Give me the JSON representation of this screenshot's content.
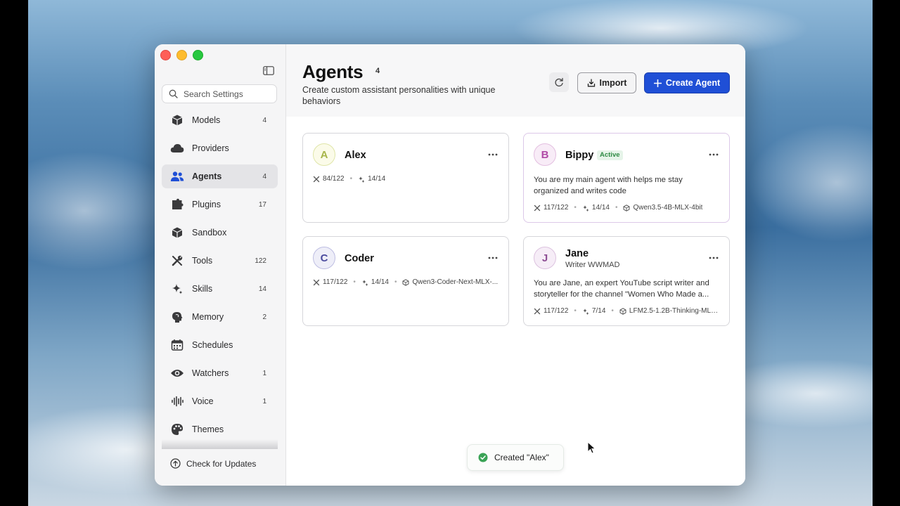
{
  "sidebar": {
    "search_placeholder": "Search Settings",
    "items": [
      {
        "label": "Models",
        "count": "4",
        "icon": "cube-icon"
      },
      {
        "label": "Providers",
        "count": "",
        "icon": "cloud-icon"
      },
      {
        "label": "Agents",
        "count": "4",
        "icon": "people-icon",
        "active": true
      },
      {
        "label": "Plugins",
        "count": "17",
        "icon": "plugin-icon"
      },
      {
        "label": "Sandbox",
        "count": "",
        "icon": "box-icon"
      },
      {
        "label": "Tools",
        "count": "122",
        "icon": "tools-icon"
      },
      {
        "label": "Skills",
        "count": "14",
        "icon": "sparkle-icon"
      },
      {
        "label": "Memory",
        "count": "2",
        "icon": "brain-icon"
      },
      {
        "label": "Schedules",
        "count": "",
        "icon": "calendar-icon"
      },
      {
        "label": "Watchers",
        "count": "1",
        "icon": "eye-icon"
      },
      {
        "label": "Voice",
        "count": "1",
        "icon": "waveform-icon"
      },
      {
        "label": "Themes",
        "count": "",
        "icon": "palette-icon"
      }
    ],
    "check_updates": "Check for Updates"
  },
  "header": {
    "title": "Agents",
    "count": "4",
    "subtitle": "Create custom assistant personalities with unique behaviors",
    "import_label": "Import",
    "create_label": "Create Agent"
  },
  "agents": [
    {
      "initial": "A",
      "name": "Alex",
      "role": "",
      "badge": "",
      "desc1": "",
      "desc2": "",
      "tools": "84/122",
      "skills": "14/14",
      "model": "",
      "colors": {
        "bg": "#fbfbe9",
        "border": "#dfe5a8",
        "text": "#a7b54a"
      }
    },
    {
      "initial": "B",
      "name": "Bippy",
      "role": "",
      "badge": "Active",
      "desc1": "You are my main agent with helps me stay",
      "desc2": "organized and writes code",
      "tools": "117/122",
      "skills": "14/14",
      "model": "Qwen3.5-4B-MLX-4bit",
      "colors": {
        "bg": "#f8ecf7",
        "border": "#e3bfe0",
        "text": "#b04aa6"
      }
    },
    {
      "initial": "C",
      "name": "Coder",
      "role": "",
      "badge": "",
      "desc1": "",
      "desc2": "",
      "tools": "117/122",
      "skills": "14/14",
      "model": "Qwen3-Coder-Next-MLX-...",
      "colors": {
        "bg": "#eeeef8",
        "border": "#bdbde2",
        "text": "#4b4b9e"
      }
    },
    {
      "initial": "J",
      "name": "Jane",
      "role": "Writer WWMAD",
      "badge": "",
      "desc1": "You are Jane, an expert YouTube script writer and",
      "desc2": "storyteller for the channel \"Women Who Made a...",
      "tools": "117/122",
      "skills": "7/14",
      "model": "LFM2.5-1.2B-Thinking-MLX...",
      "colors": {
        "bg": "#f6edf7",
        "border": "#dcc2df",
        "text": "#8e4f95"
      }
    }
  ],
  "toast": {
    "message": "Created \"Alex\""
  },
  "colors": {
    "accent": "#1f4fd6",
    "success": "#3aa356"
  }
}
